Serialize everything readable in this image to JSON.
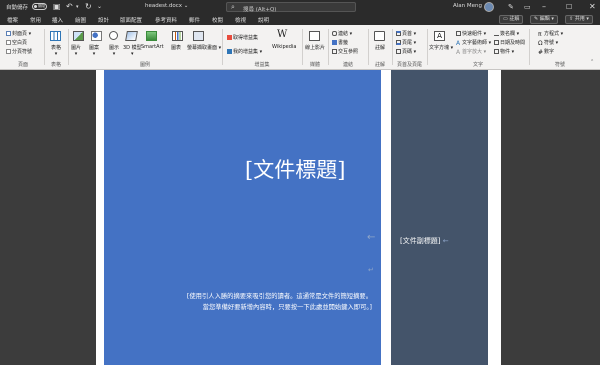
{
  "titlebar": {
    "autosave_label": "自動儲存",
    "autosave_state": "關閉",
    "doc_title": "headest.docx",
    "search_placeholder": "搜尋 (Alt+Q)",
    "user": "Alan Meng"
  },
  "tabs": [
    "檔案",
    "常用",
    "插入",
    "繪圖",
    "設計",
    "版面配置",
    "參考資料",
    "郵件",
    "校閱",
    "檢視",
    "說明"
  ],
  "tab_active": "插入",
  "ribbon_buttons": {
    "comments": "註解",
    "editing": "編輯",
    "share": "共用"
  },
  "ribbon": {
    "pages": {
      "label": "頁面",
      "items": [
        "封面頁",
        "空白頁",
        "分頁符號"
      ]
    },
    "tables": {
      "label": "表格",
      "items": [
        "表格"
      ]
    },
    "illustrations": {
      "label": "圖例",
      "items": [
        "圖片",
        "圖案",
        "圖示",
        "3D 模型",
        "SmartArt",
        "圖表",
        "螢幕擷取畫面"
      ]
    },
    "addins": {
      "label": "增益集",
      "items": [
        "取得增益集",
        "我的增益集",
        "Wikipedia"
      ]
    },
    "media": {
      "label": "媒體",
      "items": [
        "線上影片"
      ]
    },
    "links": {
      "label": "連結",
      "items": [
        "連結",
        "書籤",
        "交互參照"
      ]
    },
    "comments": {
      "label": "註解",
      "items": [
        "註解"
      ]
    },
    "header_footer": {
      "label": "頁首及頁尾",
      "items": [
        "頁首",
        "頁尾",
        "頁碼"
      ]
    },
    "text": {
      "label": "文字",
      "items": [
        "文字方塊",
        "快速組件",
        "文字藝術師",
        "首字放大",
        "簽名欄",
        "日期及時間",
        "物件"
      ]
    },
    "symbols": {
      "label": "符號",
      "items": [
        "方程式",
        "符號",
        "數字"
      ]
    }
  },
  "document": {
    "title": "[文件標題]",
    "subtitle": "[文件副標題]",
    "abstract_line1": "[使用引人入勝的摘要來吸引您的讀者。這通常是文件的簡短摘要。",
    "abstract_line2": "當您準備好要新增內容時，只要按一下此處並開始鍵入即可。]"
  },
  "colors": {
    "title_bar": "#2b2b2b",
    "ribbon": "#f3f2f1",
    "canvas": "#3c3c3c",
    "blue_panel": "#4472c4",
    "side_panel": "#44546a"
  }
}
